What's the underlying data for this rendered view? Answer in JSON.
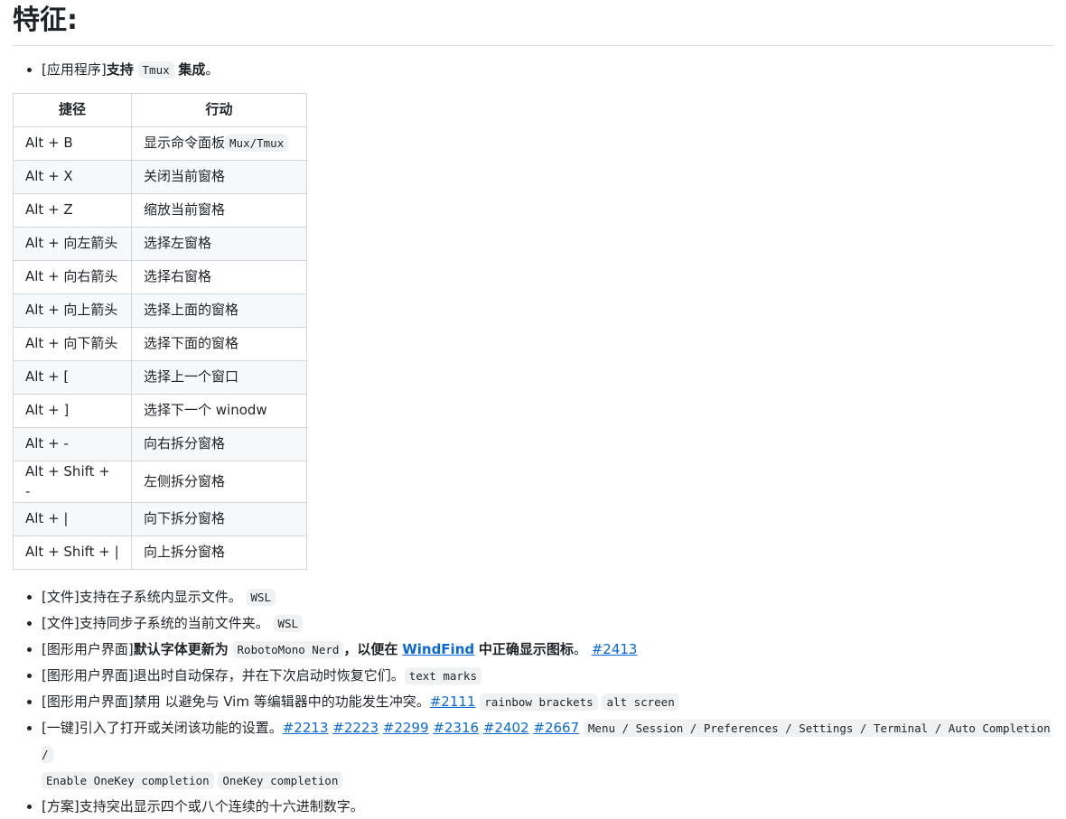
{
  "heading": "特征:",
  "top_item": {
    "tag": "[应用程序]",
    "bold_start": "支持",
    "code": "Tmux",
    "bold_end": "集成",
    "end": "。"
  },
  "table": {
    "headers": [
      "捷径",
      "行动"
    ],
    "rows": [
      {
        "shortcut": "Alt + B",
        "action": "显示命令面板",
        "code": "Mux/Tmux"
      },
      {
        "shortcut": "Alt + X",
        "action": "关闭当前窗格"
      },
      {
        "shortcut": "Alt + Z",
        "action": "缩放当前窗格"
      },
      {
        "shortcut": "Alt + 向左箭头",
        "action": "选择左窗格"
      },
      {
        "shortcut": "Alt + 向右箭头",
        "action": "选择右窗格"
      },
      {
        "shortcut": "Alt + 向上箭头",
        "action": "选择上面的窗格"
      },
      {
        "shortcut": "Alt + 向下箭头",
        "action": "选择下面的窗格"
      },
      {
        "shortcut": "Alt + [",
        "action": "选择上一个窗口"
      },
      {
        "shortcut": "Alt + ]",
        "action": "选择下一个 winodw"
      },
      {
        "shortcut": "Alt + -",
        "action": "向右拆分窗格"
      },
      {
        "shortcut": "Alt + Shift + -",
        "action": "左侧拆分窗格"
      },
      {
        "shortcut": "Alt + |",
        "action": "向下拆分窗格"
      },
      {
        "shortcut": "Alt + Shift + |",
        "action": "向上拆分窗格"
      }
    ]
  },
  "items": {
    "i1": {
      "text": "[文件]支持在子系统内显示文件。",
      "code": "WSL"
    },
    "i2": {
      "text": "[文件]支持同步子系统的当前文件夹。",
      "code": "WSL"
    },
    "i3": {
      "tag": "[图形用户界面]",
      "bold1": "默认字体更新为",
      "code": "RobotoMono Nerd",
      "bold2": "，以便在",
      "link": "WindFind",
      "bold3": "中正确显示图标",
      "end": "。",
      "issue": "#2413"
    },
    "i4": {
      "text": "[图形用户界面]退出时自动保存，并在下次启动时恢复它们。",
      "code": "text marks"
    },
    "i5": {
      "text": "[图形用户界面]禁用 以避免与 Vim 等编辑器中的功能发生冲突。",
      "issue": "#2111",
      "code1": "rainbow brackets",
      "code2": "alt screen"
    },
    "i6": {
      "text": "[一键]引入了打开或关闭该功能的设置。",
      "issues": [
        "#2213",
        "#2223",
        "#2299",
        "#2316",
        "#2402",
        "#2667"
      ],
      "code1a": "Menu / Session / Preferences / Settings / Terminal / Auto Completion /",
      "code1b": "Enable OneKey completion",
      "code2": "OneKey completion"
    },
    "i7": {
      "text": "[方案]支持突出显示四个或八个连续的十六进制数字。"
    }
  }
}
